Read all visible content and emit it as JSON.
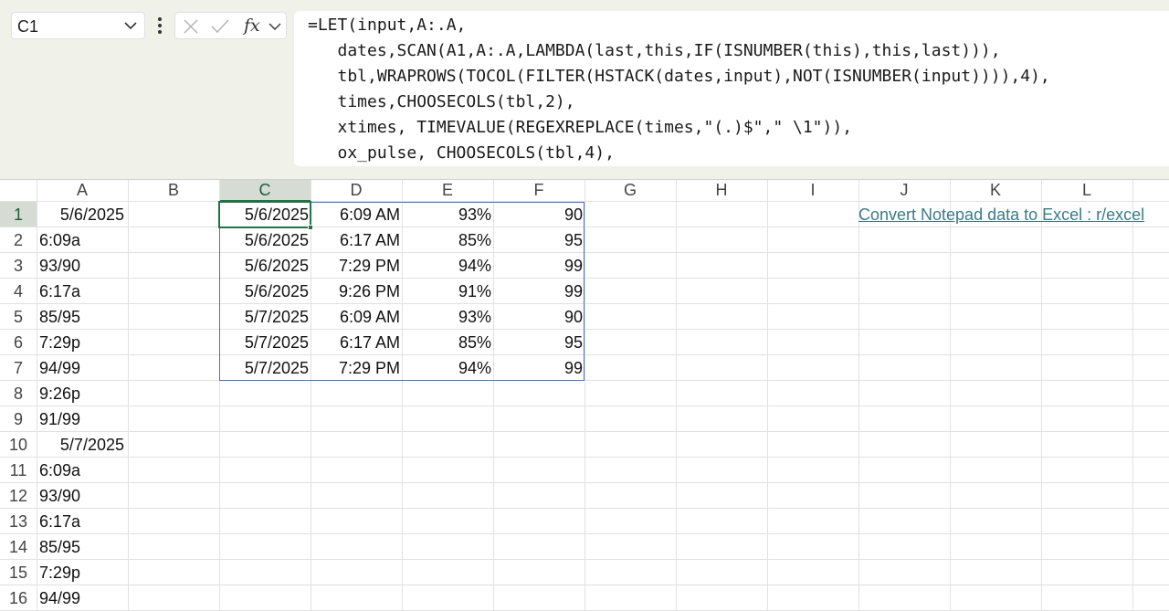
{
  "name_box": {
    "value": "C1"
  },
  "formula_bar": {
    "lines": [
      "=LET(input,A:.A,",
      "   dates,SCAN(A1,A:.A,LAMBDA(last,this,IF(ISNUMBER(this),this,last))),",
      "   tbl,WRAPROWS(TOCOL(FILTER(HSTACK(dates,input),NOT(ISNUMBER(input)))),4),",
      "   times,CHOOSECOLS(tbl,2),",
      "   xtimes, TIMEVALUE(REGEXREPLACE(times,\"(.)$\",\" \\1\")),",
      "   ox_pulse, CHOOSECOLS(tbl,4),"
    ]
  },
  "icons": {
    "namebox_dropdown": "chevron-down-icon",
    "more": "vertical-ellipsis-icon",
    "cancel": "close-icon",
    "enter": "check-icon",
    "function": "fx-icon",
    "formula_expand": "chevron-down-icon"
  },
  "colors": {
    "selected_header": "#d6dcd3",
    "active_cell_border": "#217346",
    "spill_border": "#4472c4",
    "hyperlink": "#3b7a86"
  },
  "grid": {
    "columns": [
      "A",
      "B",
      "C",
      "D",
      "E",
      "F",
      "G",
      "H",
      "I",
      "J",
      "K",
      "L"
    ],
    "selected_column": "C",
    "rows": [
      "1",
      "2",
      "3",
      "4",
      "5",
      "6",
      "7",
      "8",
      "9",
      "10",
      "11",
      "12",
      "13",
      "14",
      "15",
      "16"
    ],
    "selected_row": "1",
    "column_a": [
      "5/6/2025",
      "6:09a",
      "93/90",
      "6:17a",
      "85/95",
      "7:29p",
      "94/99",
      "9:26p",
      "91/99",
      "5/7/2025",
      "6:09a",
      "93/90",
      "6:17a",
      "85/95",
      "7:29p",
      "94/99"
    ],
    "spill_table": [
      [
        "5/6/2025",
        "6:09 AM",
        "93%",
        "90"
      ],
      [
        "5/6/2025",
        "6:17 AM",
        "85%",
        "95"
      ],
      [
        "5/6/2025",
        "7:29 PM",
        "94%",
        "99"
      ],
      [
        "5/6/2025",
        "9:26 PM",
        "91%",
        "99"
      ],
      [
        "5/7/2025",
        "6:09 AM",
        "93%",
        "90"
      ],
      [
        "5/7/2025",
        "6:17 AM",
        "85%",
        "95"
      ],
      [
        "5/7/2025",
        "7:29 PM",
        "94%",
        "99"
      ]
    ],
    "link_text": "Convert Notepad data to Excel : r/excel"
  }
}
